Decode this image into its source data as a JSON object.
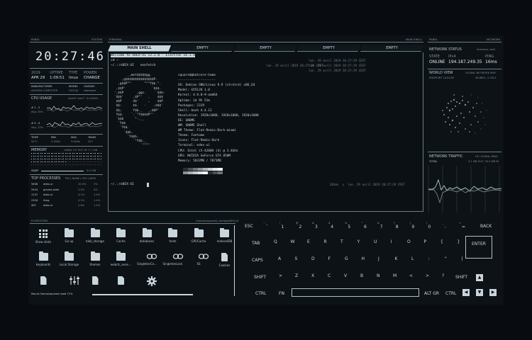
{
  "panels": {
    "panel_left": "PANEL",
    "system": "SYSTEM",
    "terminal": "TERMINAL",
    "main_shell": "MAIN SHELL",
    "panel_right": "PANEL",
    "network": "NETWORK",
    "filesystem": "FILESYSTEM",
    "fs_path": "/home/squared/.config/eDEX-UI"
  },
  "clock": "20:27:46",
  "sysinfo": {
    "headers": [
      "2019",
      "UPTIME",
      "TYPE",
      "POWER"
    ],
    "values": [
      "APR 29",
      "1:09:51",
      "linux",
      "CHARGE"
    ],
    "hw_headers": [
      "MANUFACTURER",
      "MODEL",
      "CHASSIS"
    ],
    "hw_values": [
      "ASUSTeK COMPUTER",
      "G551JK",
      "Notebook"
    ]
  },
  "cpu": {
    "label": "CPU USAGE",
    "model": "Intel® Core™ i5-4200H",
    "rows": [
      {
        "id": "# 1 - 2",
        "avg": "Avg. 20%"
      },
      {
        "id": "# 3 - 4",
        "avg": "Avg. 21%"
      }
    ],
    "stat_headers": [
      "TEMP",
      "MIN",
      "MAX",
      "TASKS"
    ],
    "stat_values": [
      "52°C",
      "2.3GHz",
      "3.4GHz",
      "257"
    ]
  },
  "memory": {
    "label": "MEMORY",
    "usage": "USING 5.5 OUT OF 7.7 GiB",
    "swap_label": "SWAP",
    "swap_value": "0.0 GiB"
  },
  "processes": {
    "label": "TOP PROCESSES",
    "columns": "PID | NAME | CPU | MEM",
    "rows": [
      {
        "pid": "5636",
        "name": "edex-ui",
        "cpu": "10.3%",
        "mem": "2%"
      },
      {
        "pid": "2424",
        "name": "gnome-shell",
        "cpu": "5.4%",
        "mem": "4%"
      },
      {
        "pid": "1137",
        "name": "edex-ui",
        "cpu": "4.1%",
        "mem": "1.4%"
      },
      {
        "pid": "2316",
        "name": "Xorg",
        "cpu": "4.1%",
        "mem": "1.4%"
      },
      {
        "pid": "567",
        "name": "edex-ui",
        "cpu": "2.8%",
        "mem": "1.4%"
      }
    ]
  },
  "tabs": [
    "MAIN SHELL",
    "EMPTY",
    "EMPTY",
    "EMPTY",
    "EMPTY"
  ],
  "terminal": {
    "welcome": "Welcome to eDEX-UI v2.2.0 - Electron v4.1.4",
    "cmd1": "cd ~",
    "prompt1": "~/.:/eDEX-UI   neofetch",
    "prompt2": "~/.:/eDEX-UI",
    "timestamps": [
      "lun. 29 avril 2019 20:27:29 CEST",
      "lun. 29 avril 2019 20:27:29 CEST",
      "lun. 29 avril 2019 20:27:29 CEST",
      "lun. 29 avril 2019 20:27:29 CEST"
    ],
    "last_time": "381ms  ❮  lun. 29 avril 2019 20:27:29 CEST",
    "logo": [
      "       _,met$$$$$gg.",
      "    ,g$$$$$$$$$$$$$$$P.",
      "  ,g$$P\"\"       \"\"\"Y$$.\".",
      " ,$$P'              `$$$.",
      "',$$P       ,ggs.     `$$b:",
      "`d$$'     ,$P\"'   .    $$$",
      " $$P      d$'     ,    $$P",
      " $$:      $$.   -    ,d$$'",
      " $$;      Y$b._   _,d$P'",
      " Y$$.    `.`\"Y$$$$P\"'",
      " `$$b      \"-.__",
      "  `Y$$",
      "   `Y$$.",
      "     `$$b.",
      "       `Y$$b.",
      "          `\"Y$b._",
      "              `\"\"\"\""
    ],
    "info": [
      "squared@batcore-home",
      "--------------------",
      "OS: Debian GNU/Linux 9.9 (stretch) x86_64",
      "Model: G551JK 1.0",
      "Kernel: 4.9.0-9-amd64",
      "Uptime: 1d 9h 51m",
      "Packages: 2319",
      "Shell: bash 4.4.12",
      "Resolution: 1920x1080, 1920x1080, 1920x1080",
      "DE: GNOME",
      "WM: GNOME Shell",
      "WM Theme: Flat-Remix-Dark-miami",
      "Theme: Fantome",
      "Icons: Flat-Remix-Dark",
      "Terminal: edex-ui",
      "CPU: Intel i5-4200H (4) @ 3.4GHz",
      "GPU: NVIDIA GeForce GTX 850M",
      "Memory: 5832MB / 7871MB"
    ]
  },
  "network": {
    "status_label": "NETWORK STATUS",
    "interface": "Interface: lan0",
    "headers": [
      "STATE",
      "IPv4",
      "PING"
    ],
    "values": [
      "ONLINE",
      "194.187.249.35",
      "16ms"
    ],
    "world_label": "WORLD VIEW",
    "world_sub": "GLOBAL NETWORK MAP",
    "endpoint": "ENDPOINT LAT/LON",
    "endpoint_val": "48.8601, 2.3411",
    "traffic_label": "NETWORK TRAFFIC",
    "traffic_sub": "UP / DOWN, MB/S",
    "total_label": "TOTAL",
    "total_val": "3.1 MB OUT, 50.0 MB IN"
  },
  "files": [
    {
      "name": "Show disks",
      "icon": "grid",
      "link": false
    },
    {
      "name": "Go up",
      "icon": "folder",
      "link": false
    },
    {
      "name": "blob_storage",
      "icon": "folder",
      "link": false
    },
    {
      "name": "Cache",
      "icon": "folder",
      "link": false
    },
    {
      "name": "databases",
      "icon": "folder",
      "link": false
    },
    {
      "name": "fonts",
      "icon": "folder",
      "link": false
    },
    {
      "name": "GPUCache",
      "icon": "folder",
      "link": false
    },
    {
      "name": "IndexedDB",
      "icon": "folder",
      "link": false
    },
    {
      "name": "keyboards",
      "icon": "folder",
      "link": false
    },
    {
      "name": "Local Storage",
      "icon": "folder",
      "link": false
    },
    {
      "name": "themes",
      "icon": "folder",
      "link": false
    },
    {
      "name": "webrtc_even...",
      "icon": "folder",
      "link": false
    },
    {
      "name": "SingletonCo...",
      "icon": "link",
      "link": true
    },
    {
      "name": "SingletonLock",
      "icon": "link",
      "link": true
    },
    {
      "name": "SS",
      "icon": "link",
      "link": true
    },
    {
      "name": "Cookies",
      "icon": "file",
      "link": false
    },
    {
      "name": "",
      "icon": "file",
      "link": false
    },
    {
      "name": "",
      "icon": "sliders",
      "link": false
    },
    {
      "name": "",
      "icon": "file",
      "link": false
    },
    {
      "name": "",
      "icon": "file",
      "link": false
    },
    {
      "name": "",
      "icon": "gear",
      "link": false
    }
  ],
  "mount": "Mount  /home/squared  used  71%",
  "keyboard": {
    "esc": "ESC",
    "backspace": "BACK",
    "tab": "TAB",
    "enter": "ENTER",
    "caps": "CAPS",
    "shift_l": "SHIFT",
    "shift_r": "SHIFT",
    "ctrl_l": "CTRL",
    "fn": "FN",
    "altgr": "ALT GR",
    "ctrl_r": "CTRL",
    "row1": [
      [
        "~",
        "`"
      ],
      [
        "!",
        "1"
      ],
      [
        "@",
        "2"
      ],
      [
        "#",
        "3"
      ],
      [
        "$",
        "4"
      ],
      [
        "%",
        "5"
      ],
      [
        "^",
        "6"
      ],
      [
        "&",
        "7"
      ],
      [
        "*",
        "8"
      ],
      [
        "(",
        "9"
      ],
      [
        ")",
        "0"
      ],
      [
        "_",
        "-"
      ],
      [
        "+",
        "="
      ]
    ],
    "row2": [
      "Q",
      "W",
      "E",
      "R",
      "T",
      "Y",
      "U",
      "I",
      "O",
      "P",
      "{",
      "}"
    ],
    "row3": [
      "A",
      "S",
      "D",
      "F",
      "G",
      "H",
      "J",
      "K",
      "L",
      ":",
      "\"",
      "|"
    ],
    "row4": [
      ">",
      "Z",
      "X",
      "C",
      "V",
      "B",
      "N",
      "M",
      "<",
      ">",
      "?"
    ],
    "arrows": [
      "▲",
      "◀",
      "▼",
      "▶"
    ]
  }
}
